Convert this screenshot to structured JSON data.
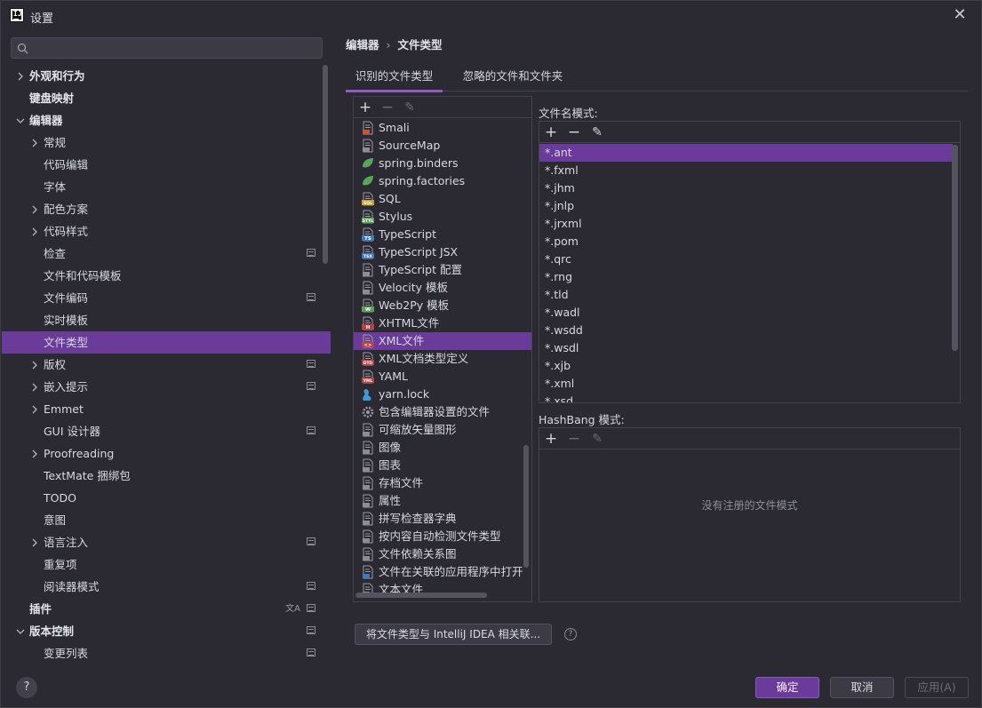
{
  "window": {
    "title": "设置"
  },
  "search": {
    "placeholder": ""
  },
  "sidebar": {
    "items": [
      {
        "label": "外观和行为",
        "arrow": "right",
        "bold": true,
        "indent": 0
      },
      {
        "label": "键盘映射",
        "arrow": "",
        "bold": true,
        "indent": 0
      },
      {
        "label": "编辑器",
        "arrow": "down",
        "bold": true,
        "indent": 0
      },
      {
        "label": "常规",
        "arrow": "right",
        "bold": false,
        "indent": 1
      },
      {
        "label": "代码编辑",
        "arrow": "",
        "bold": false,
        "indent": 1
      },
      {
        "label": "字体",
        "arrow": "",
        "bold": false,
        "indent": 1
      },
      {
        "label": "配色方案",
        "arrow": "right",
        "bold": false,
        "indent": 1
      },
      {
        "label": "代码样式",
        "arrow": "right",
        "bold": false,
        "indent": 1
      },
      {
        "label": "检查",
        "arrow": "",
        "bold": false,
        "indent": 1,
        "project": true
      },
      {
        "label": "文件和代码模板",
        "arrow": "",
        "bold": false,
        "indent": 1
      },
      {
        "label": "文件编码",
        "arrow": "",
        "bold": false,
        "indent": 1,
        "project": true
      },
      {
        "label": "实时模板",
        "arrow": "",
        "bold": false,
        "indent": 1
      },
      {
        "label": "文件类型",
        "arrow": "",
        "bold": false,
        "indent": 1,
        "selected": true
      },
      {
        "label": "版权",
        "arrow": "right",
        "bold": false,
        "indent": 1,
        "project": true
      },
      {
        "label": "嵌入提示",
        "arrow": "right",
        "bold": false,
        "indent": 1,
        "project": true
      },
      {
        "label": "Emmet",
        "arrow": "right",
        "bold": false,
        "indent": 1
      },
      {
        "label": "GUI 设计器",
        "arrow": "",
        "bold": false,
        "indent": 1,
        "project": true
      },
      {
        "label": "Proofreading",
        "arrow": "right",
        "bold": false,
        "indent": 1
      },
      {
        "label": "TextMate 捆绑包",
        "arrow": "",
        "bold": false,
        "indent": 1
      },
      {
        "label": "TODO",
        "arrow": "",
        "bold": false,
        "indent": 1
      },
      {
        "label": "意图",
        "arrow": "",
        "bold": false,
        "indent": 1
      },
      {
        "label": "语言注入",
        "arrow": "right",
        "bold": false,
        "indent": 1,
        "project": true
      },
      {
        "label": "重复项",
        "arrow": "",
        "bold": false,
        "indent": 1
      },
      {
        "label": "阅读器模式",
        "arrow": "",
        "bold": false,
        "indent": 1,
        "project": true
      },
      {
        "label": "插件",
        "arrow": "",
        "bold": true,
        "indent": 0,
        "project": true,
        "translate": true
      },
      {
        "label": "版本控制",
        "arrow": "down",
        "bold": true,
        "indent": 0,
        "project": true
      },
      {
        "label": "变更列表",
        "arrow": "",
        "bold": false,
        "indent": 1,
        "project": true
      }
    ]
  },
  "breadcrumb": {
    "parent": "编辑器",
    "separator": "›",
    "current": "文件类型"
  },
  "tabs": [
    {
      "label": "识别的文件类型",
      "active": true
    },
    {
      "label": "忽略的文件和文件夹",
      "active": false
    }
  ],
  "toolbar": {
    "add": "+",
    "remove": "−",
    "edit": "✎"
  },
  "file_types": [
    {
      "label": "Smali",
      "icon": "smali-file-icon",
      "color": "#c05a2a",
      "badge": ""
    },
    {
      "label": "SourceMap",
      "icon": "sourcemap-file-icon",
      "color": "#8c8c96",
      "badge": ""
    },
    {
      "label": "spring.binders",
      "icon": "spring-icon",
      "color": "#5aa35a",
      "badge": ""
    },
    {
      "label": "spring.factories",
      "icon": "spring-icon",
      "color": "#5aa35a",
      "badge": ""
    },
    {
      "label": "SQL",
      "icon": "sql-file-icon",
      "color": "#c9a227",
      "badge": "SQL"
    },
    {
      "label": "Stylus",
      "icon": "stylus-file-icon",
      "color": "#5aa35a",
      "badge": "STYL"
    },
    {
      "label": "TypeScript",
      "icon": "typescript-file-icon",
      "color": "#3c7bc4",
      "badge": "TS"
    },
    {
      "label": "TypeScript JSX",
      "icon": "tsx-file-icon",
      "color": "#3c7bc4",
      "badge": "TSX"
    },
    {
      "label": "TypeScript 配置",
      "icon": "tsconfig-file-icon",
      "color": "#8c8c96",
      "badge": ""
    },
    {
      "label": "Velocity 模板",
      "icon": "velocity-file-icon",
      "color": "#8c8c96",
      "badge": ""
    },
    {
      "label": "Web2Py 模板",
      "icon": "web2py-file-icon",
      "color": "#5aa35a",
      "badge": "W"
    },
    {
      "label": "XHTML文件",
      "icon": "xhtml-file-icon",
      "color": "#c04040",
      "badge": "H"
    },
    {
      "label": "XML文件",
      "icon": "xml-file-icon",
      "color": "#c04040",
      "badge": "<>",
      "selected": true
    },
    {
      "label": "XML文档类型定义",
      "icon": "dtd-file-icon",
      "color": "#c04040",
      "badge": "DTD"
    },
    {
      "label": "YAML",
      "icon": "yaml-file-icon",
      "color": "#c04040",
      "badge": "YML"
    },
    {
      "label": "yarn.lock",
      "icon": "yarn-icon",
      "color": "#3b9bd6",
      "badge": ""
    },
    {
      "label": "包含编辑器设置的文件",
      "icon": "gear-icon",
      "color": "#9a9aa4",
      "badge": ""
    },
    {
      "label": "可缩放矢量图形",
      "icon": "svg-file-icon",
      "color": "#8c8c96",
      "badge": ""
    },
    {
      "label": "图像",
      "icon": "image-file-icon",
      "color": "#8c8c96",
      "badge": ""
    },
    {
      "label": "图表",
      "icon": "diagram-file-icon",
      "color": "#8c8c96",
      "badge": ""
    },
    {
      "label": "存档文件",
      "icon": "archive-file-icon",
      "color": "#8c8c96",
      "badge": ""
    },
    {
      "label": "属性",
      "icon": "properties-file-icon",
      "color": "#8c8c96",
      "badge": ""
    },
    {
      "label": "拼写检查器字典",
      "icon": "dictionary-file-icon",
      "color": "#8c8c96",
      "badge": ""
    },
    {
      "label": "按内容自动检测文件类型",
      "icon": "text-file-icon",
      "color": "#8c8c96",
      "badge": ""
    },
    {
      "label": "文件依赖关系图",
      "icon": "dependency-diagram-icon",
      "color": "#8c8c96",
      "badge": ""
    },
    {
      "label": "文件在关联的应用程序中打开",
      "icon": "external-file-icon",
      "color": "#3c7bc4",
      "badge": ""
    },
    {
      "label": "文本文件",
      "icon": "text-file-icon",
      "color": "#8c8c96",
      "badge": ""
    }
  ],
  "patterns": {
    "label": "文件名模式:",
    "items": [
      "*.ant",
      "*.fxml",
      "*.jhm",
      "*.jnlp",
      "*.jrxml",
      "*.pom",
      "*.qrc",
      "*.rng",
      "*.tld",
      "*.wadl",
      "*.wsdd",
      "*.wsdl",
      "*.xjb",
      "*.xml",
      "*.xsd"
    ],
    "selected_index": 0
  },
  "hashbang": {
    "label": "HashBang 模式:",
    "empty_text": "没有注册的文件模式"
  },
  "associate_button": "将文件类型与 IntelliJ IDEA 相关联...",
  "help_icon": "?",
  "buttons": {
    "ok": "确定",
    "cancel": "取消",
    "apply": "应用(A)"
  },
  "colors": {
    "accent": "#6b3b9a",
    "background": "#2b2a33",
    "border": "#44434d"
  }
}
